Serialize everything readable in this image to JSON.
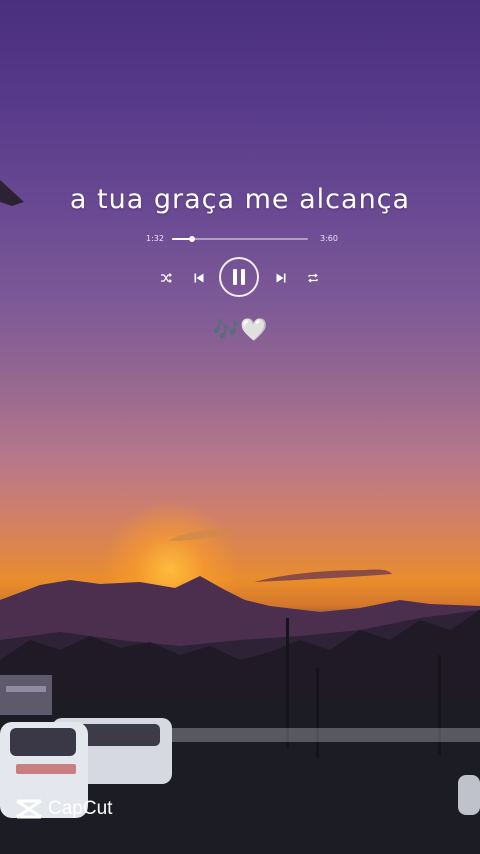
{
  "player": {
    "lyric": "a tua graça me alcança",
    "elapsed": "1:32",
    "duration": "3:60",
    "progress": 0.15,
    "emojis": "🎶🤍"
  },
  "controls": {
    "shuffle_icon": "shuffle-icon",
    "previous_icon": "skip-previous-icon",
    "pause_icon": "pause-icon",
    "next_icon": "skip-next-icon",
    "repeat_icon": "repeat-icon"
  },
  "watermark": {
    "label": "CapCut"
  },
  "colors": {
    "sky_top": "#4a2f7e",
    "horizon": "#e98d2b",
    "icon": "#ffffff"
  }
}
